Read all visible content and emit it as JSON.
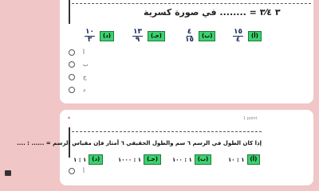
{
  "question1": {
    "text": "٣ ٣⁄٤ = ........ في صورة كسرية",
    "choices": [
      {
        "tag": "(أ)",
        "num": "١٥",
        "den": "٤"
      },
      {
        "tag": "(ب)",
        "num": "٤",
        "den": "١٥"
      },
      {
        "tag": "(جـ)",
        "num": "١٣",
        "den": "٩"
      },
      {
        "tag": "(د)",
        "num": "١٠",
        "den": "٣"
      }
    ],
    "options": [
      "أ",
      "ب",
      "ج",
      "د"
    ]
  },
  "question2": {
    "required_mark": "*",
    "points": "1 point",
    "text": "إذا كان الطول في الرسم ٦ سم والطول الحقيقي ٦ أمتار فإن مقياس الرسم = ...... : ....",
    "choices": [
      {
        "tag": "(أ)",
        "value": "١ : ١٠"
      },
      {
        "tag": "(ب)",
        "value": "١ : ١٠٠"
      },
      {
        "tag": "(جـ)",
        "value": "١ : ١٠٠٠"
      },
      {
        "tag": "(د)",
        "value": "١ : ١"
      }
    ],
    "options": [
      "أ"
    ]
  }
}
